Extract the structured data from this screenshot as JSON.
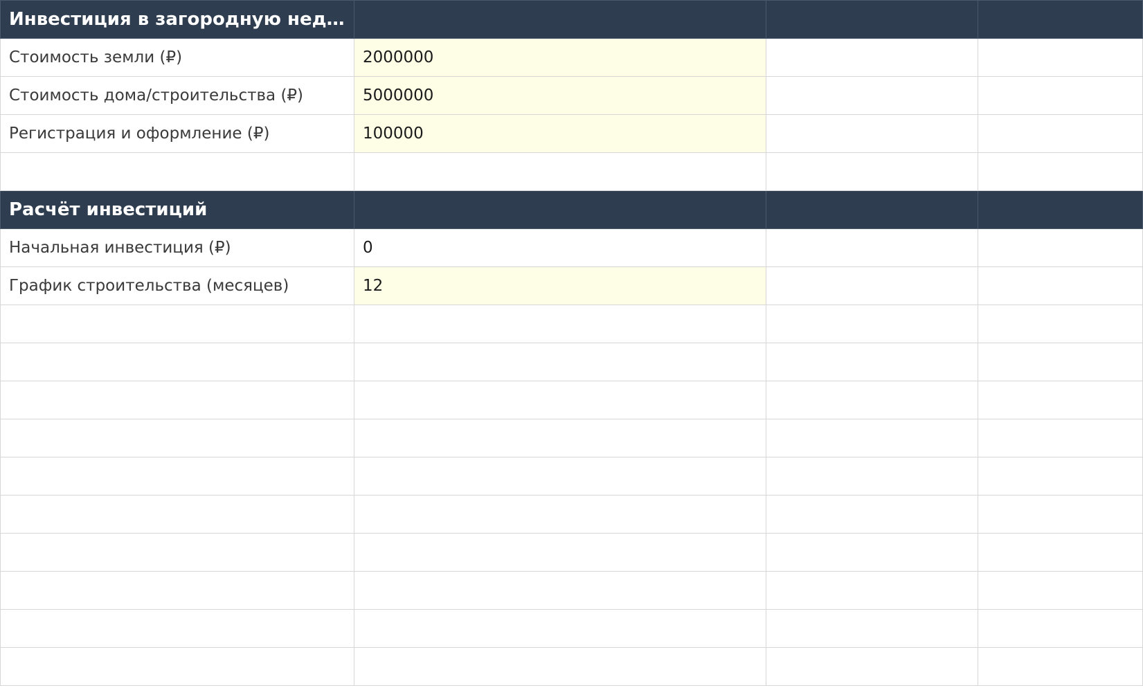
{
  "sheet": {
    "header1": {
      "title": "Инвестиция в загородную недви..."
    },
    "inputs": [
      {
        "label": "Стоимость земли (₽)",
        "value": "2000000"
      },
      {
        "label": "Стоимость дома/строительства (₽)",
        "value": "5000000"
      },
      {
        "label": "Регистрация и оформление (₽)",
        "value": "100000"
      }
    ],
    "header2": {
      "title": "Расчёт инвестиций"
    },
    "calc": [
      {
        "label": "Начальная инвестиция (₽)",
        "value": "0"
      },
      {
        "label": "График строительства (месяцев)",
        "value": "12"
      }
    ],
    "colors": {
      "header_bg": "#2e3d50",
      "input_bg": "#fefee6",
      "grid_line": "#d6d6d6"
    }
  }
}
